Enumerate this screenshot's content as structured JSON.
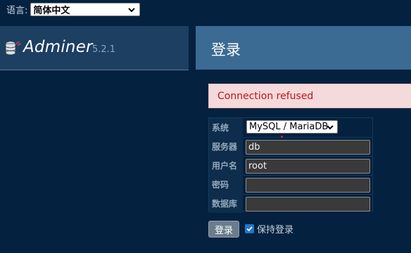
{
  "language": {
    "label": "语言:",
    "selected": "简体中文"
  },
  "app": {
    "name": "Adminer",
    "version": "5.2.1"
  },
  "page": {
    "title": "登录"
  },
  "error": {
    "message": "Connection refused"
  },
  "form": {
    "system": {
      "label": "系统",
      "value": "MySQL / MariaDB"
    },
    "server": {
      "label": "服务器",
      "value": "db"
    },
    "username": {
      "label": "用户名",
      "value": "root"
    },
    "password": {
      "label": "密码",
      "value": ""
    },
    "database": {
      "label": "数据库",
      "value": ""
    },
    "submit_label": "登录",
    "remember_label": "保持登录",
    "remember_checked": true
  },
  "colors": {
    "background": "#04213f",
    "error_text": "#c4121c",
    "checkbox": "#1f76d2"
  }
}
